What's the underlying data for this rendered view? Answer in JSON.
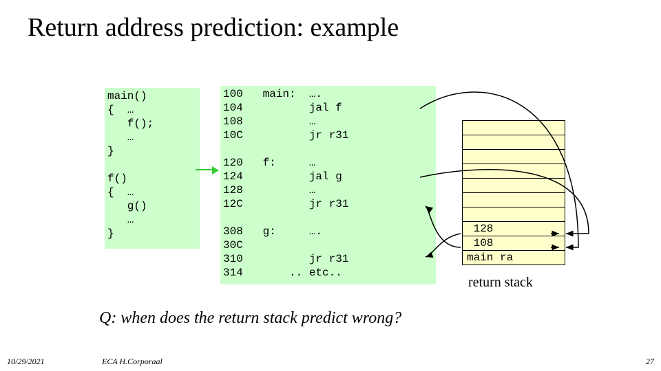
{
  "title": "Return address prediction: example",
  "left_code": "main()\n{  …\n   f();\n   …\n}\n\nf()\n{  …\n   g()\n   …\n}",
  "right_code": "100   main:  ….\n104          jal f\n108          …\n10C          jr r31\n\n120   f:     …\n124          jal g\n128          …\n12C          jr r31\n\n308   g:     ….\n30C\n310          jr r31\n314       .. etc..",
  "stack": {
    "rows": [
      "",
      "",
      "",
      "",
      "",
      "",
      "",
      " 128",
      " 108",
      "main ra"
    ],
    "caption": "return stack"
  },
  "question": "Q: when does the return stack predict wrong?",
  "footer": {
    "date": "10/29/2021",
    "source": "ECA  H.Corporaal",
    "page": "27"
  },
  "chart_data": {
    "type": "table",
    "description": "Return address stack showing pushed return addresses",
    "entries_top_to_bottom": [
      "",
      "",
      "",
      "",
      "",
      "",
      "",
      "128",
      "108",
      "main ra"
    ],
    "arrows": [
      {
        "from": "jal f (104)",
        "to_push": "108"
      },
      {
        "from": "jal g (124)",
        "to_push": "128"
      },
      {
        "from": "jr r31 in g (310)",
        "to_pop": "128"
      },
      {
        "from": "jr r31 in f (12C)",
        "to_pop": "108"
      }
    ]
  }
}
